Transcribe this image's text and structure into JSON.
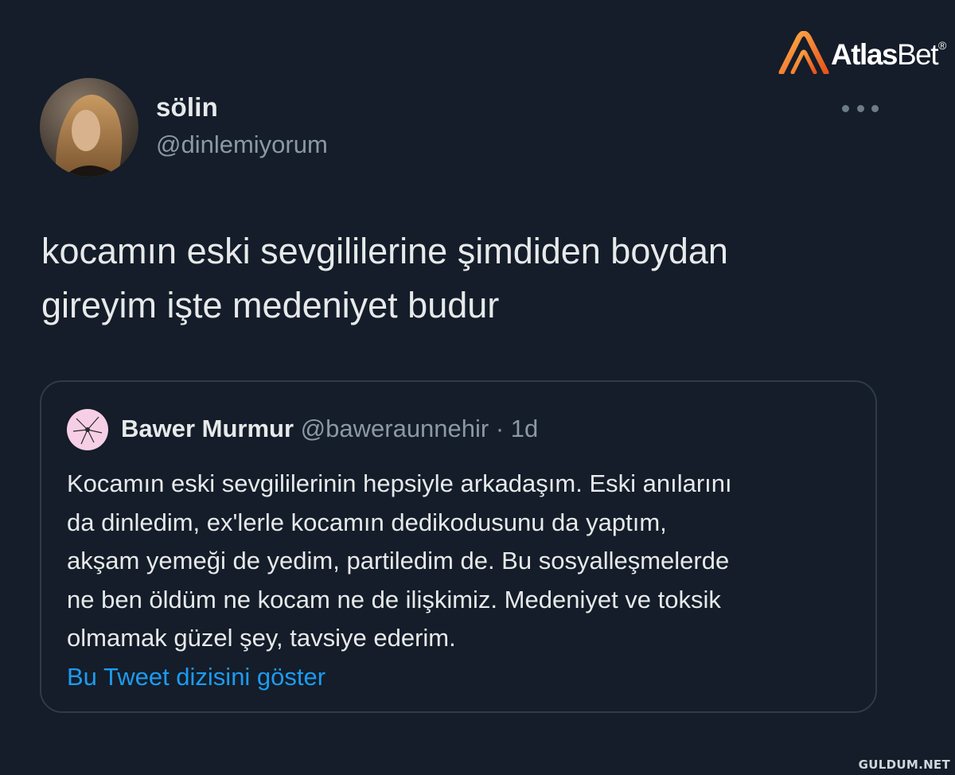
{
  "watermark": {
    "brand_bold": "Atlas",
    "brand_thin": "Bet",
    "registered": "®",
    "site": "GULDUM.NET"
  },
  "tweet": {
    "author_name": "sölin",
    "author_handle": "@dinlemiyorum",
    "text_line1": "kocamın eski sevgililerine şimdiden boydan",
    "text_line2": "gireyim işte medeniyet budur",
    "more_icon": "more-horizontal-icon"
  },
  "quote": {
    "author_name": "Bawer Murmur",
    "author_handle": "@baweraunnehir",
    "separator": "·",
    "time": "1d",
    "lines": [
      "Kocamın eski sevgililerinin hepsiyle arkadaşım. Eski anılarını",
      "da dinledim, ex'lerle kocamın dedikodusunu da yaptım,",
      "akşam yemeği de yedim, partiledim de. Bu sosyalleşmelerde",
      "ne ben öldüm ne kocam ne de ilişkimiz. Medeniyet ve toksik",
      "olmamak güzel şey, tavsiye ederim."
    ],
    "show_thread": "Bu Tweet dizisini göster"
  },
  "colors": {
    "background": "#141d29",
    "text": "#e7e9ea",
    "secondary": "#8b98a5",
    "link": "#1d9bf0",
    "border": "#2f3b48",
    "brand_orange": "#f07a1a"
  }
}
